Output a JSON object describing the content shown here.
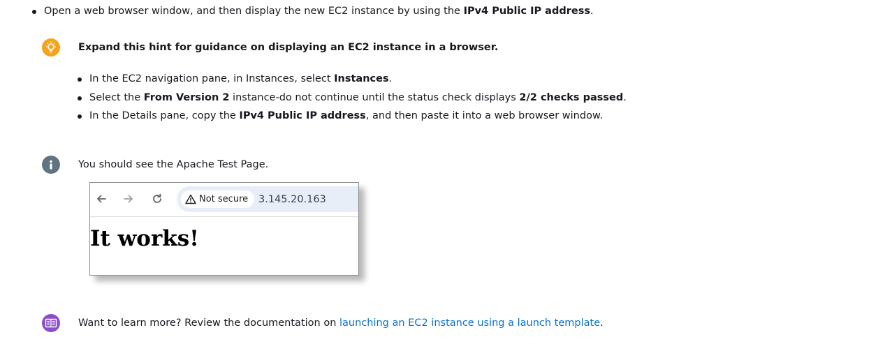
{
  "top_step": {
    "text_before": "Open a web browser window, and then display the new EC2 instance by using the ",
    "bold": "IPv4 Public IP address",
    "text_after": "."
  },
  "hint": {
    "icon": "lightbulb-icon",
    "title": "Expand this hint for guidance on displaying an EC2 instance in a browser.",
    "items": [
      {
        "pre": "In the EC2 navigation pane, in Instances, select ",
        "bold": "Instances",
        "post": "."
      },
      {
        "pre": "Select the ",
        "bold": "From Version 2",
        "mid": " instance-do not continue until the status check displays ",
        "bold2": "2/2 checks passed",
        "post": "."
      },
      {
        "pre": "In the Details pane, copy the ",
        "bold": "IPv4 Public IP address",
        "post": ", and then paste it into a web browser window."
      }
    ]
  },
  "info": {
    "icon": "info-icon",
    "text": "You should see the Apache Test Page."
  },
  "browser": {
    "security_label": "Not secure",
    "url": "3.145.20.163",
    "page_heading": "It works!"
  },
  "learn_more": {
    "icon": "book-icon",
    "text": "Want to learn more? Review the documentation on ",
    "link_text": "launching an EC2 instance using a launch template",
    "text_after": "."
  },
  "colors": {
    "hint_icon_bg": "#f6a21a",
    "info_icon_bg": "#5f7480",
    "doc_icon_bg": "#8a4fc9",
    "link": "#0972d3"
  }
}
